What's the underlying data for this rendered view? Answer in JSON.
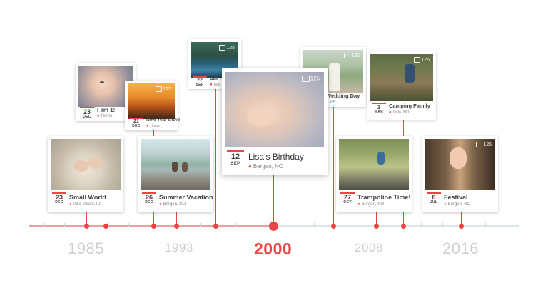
{
  "colors": {
    "accent": "#e84545",
    "axis": "#dfe5e5",
    "year_inactive": "#cfcfcf"
  },
  "timeline": {
    "years": [
      {
        "label": "1985",
        "active": false
      },
      {
        "label": "1993",
        "active": false
      },
      {
        "label": "2000",
        "active": true
      },
      {
        "label": "2008",
        "active": false
      },
      {
        "label": "2016",
        "active": false
      }
    ]
  },
  "cards": [
    {
      "id": "i-am-1",
      "title": "I am 1!",
      "day": "23",
      "month": "DEC",
      "location": "Home",
      "photo_count": "",
      "photo_icon": "baby-photo"
    },
    {
      "id": "new-years-eve",
      "title": "New Year's Eve",
      "day": "21",
      "month": "DEC",
      "location": "Home",
      "photo_count": "125",
      "photo_icon": "sunset-photo"
    },
    {
      "id": "small-world",
      "title": "Small World",
      "day": "23",
      "month": "DEC",
      "location": "Villa Insani, ID",
      "photo_count": "",
      "photo_icon": "baby-feet-photo"
    },
    {
      "id": "summer-vacation",
      "title": "Summer Vacation",
      "day": "26",
      "month": "DEC",
      "location": "Bergen, NO",
      "photo_count": "",
      "photo_icon": "lake-photo"
    },
    {
      "id": "bali-holiday",
      "title": "Bali Holiday",
      "day": "22",
      "month": "SEP",
      "location": "Bali, ID",
      "photo_count": "125",
      "photo_icon": "resort-photo"
    },
    {
      "id": "lisas-birthday",
      "title": "Lisa’s Birthday",
      "day": "12",
      "month": "SEP",
      "location": "Bergen, NO",
      "photo_count": "125",
      "photo_icon": "sleeping-baby-photo"
    },
    {
      "id": "wedding-day",
      "title": "Wedding Day",
      "day": "",
      "month": "",
      "location": "e, PA",
      "photo_count": "125",
      "photo_icon": "wedding-photo"
    },
    {
      "id": "camping-family",
      "title": "Camping Family",
      "day": "1",
      "month": "MAR",
      "location": "Oslo, NO",
      "photo_count": "125",
      "photo_icon": "camping-photo"
    },
    {
      "id": "trampoline-time",
      "title": "Trampoline Time!",
      "day": "27",
      "month": "OCT",
      "location": "Bergen, NO",
      "photo_count": "",
      "photo_icon": "trampoline-photo"
    },
    {
      "id": "festival",
      "title": "Festival",
      "day": "8",
      "month": "JUL",
      "location": "Bergen, NO",
      "photo_count": "125",
      "photo_icon": "girl-portrait-photo"
    }
  ]
}
